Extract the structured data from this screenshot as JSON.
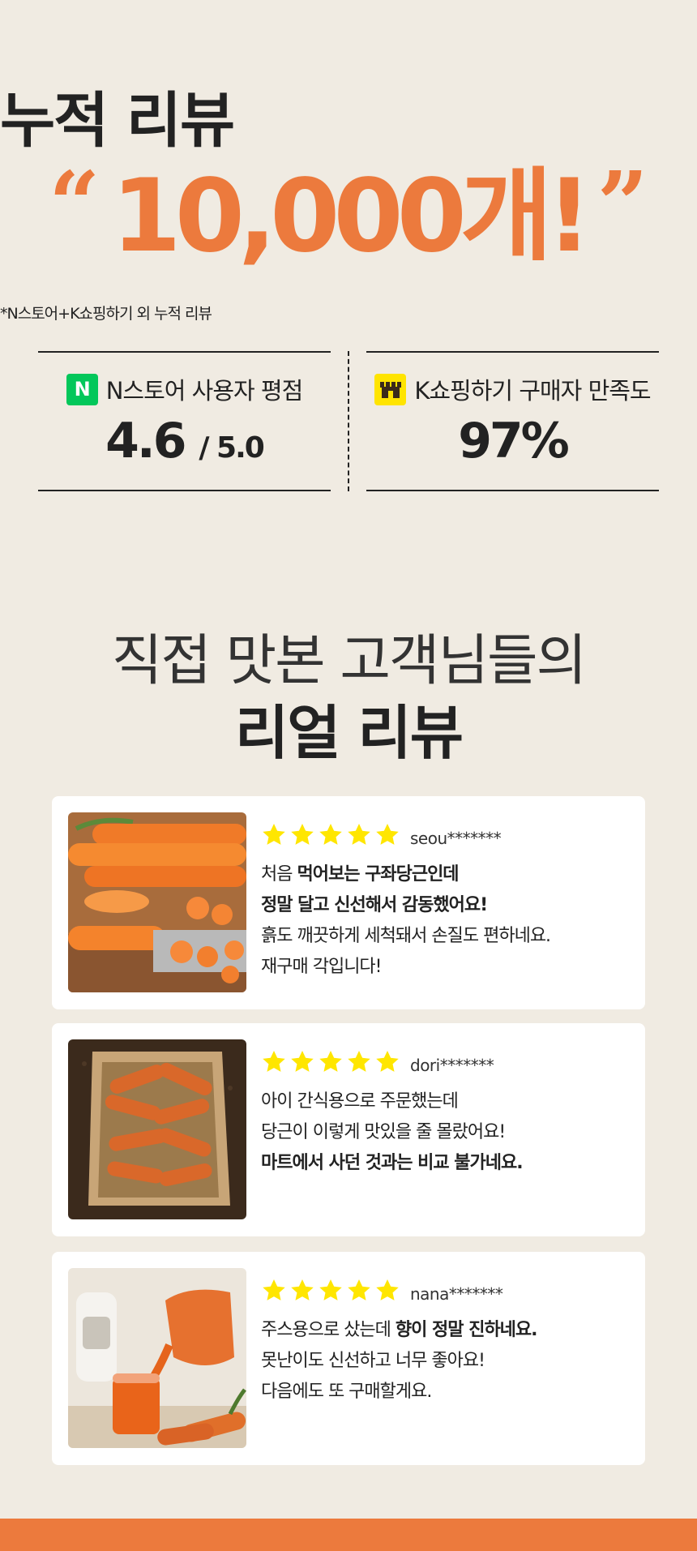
{
  "hero": {
    "title": "누적 리뷰",
    "quote_open": "“",
    "count": "10,000개!",
    "quote_close": "”",
    "note": "*N스토어+K쇼핑하기 외 누적 리뷰"
  },
  "stats": {
    "left": {
      "badge": "N",
      "label": "N스토어 사용자 평점",
      "value": "4.6",
      "suffix": "/ 5.0"
    },
    "right": {
      "label": "K쇼핑하기 구매자 만족도",
      "value": "97%"
    }
  },
  "section": {
    "subtitle": "직접 맛본 고객님들의",
    "title": "리얼 리뷰"
  },
  "reviews": [
    {
      "rating": 5,
      "reviewer": "seou*******",
      "line1_a": "처음 ",
      "line1_b": "먹어보는 구좌당근인데",
      "line2": "정말 달고 신선해서 감동했어요!",
      "line3": "흙도 깨끗하게 세척돼서 손질도 편하네요.",
      "line4": "재구매 각입니다!"
    },
    {
      "rating": 5,
      "reviewer": "dori*******",
      "line1": "아이 간식용으로 주문했는데",
      "line2": "당근이 이렇게 맛있을 줄 몰랐어요!",
      "line3": "마트에서 사던 것과는 비교 불가네요."
    },
    {
      "rating": 5,
      "reviewer": "nana*******",
      "line1_a": "주스용으로 샀는데 ",
      "line1_b": "향이 정말 진하네요.",
      "line2": "못난이도 신선하고 너무 좋아요!",
      "line3": "다음에도 또 구매할게요."
    }
  ],
  "colors": {
    "background": "#f0ebe2",
    "accent": "#ec7a3d",
    "star": "#ffe600",
    "naver_green": "#03c75a",
    "kakao_yellow": "#ffe400"
  }
}
